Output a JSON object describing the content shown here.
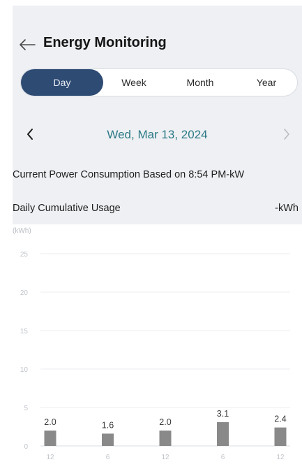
{
  "header": {
    "title": "Energy Monitoring"
  },
  "tabs": [
    {
      "label": "Day",
      "active": true
    },
    {
      "label": "Week",
      "active": false
    },
    {
      "label": "Month",
      "active": false
    },
    {
      "label": "Year",
      "active": false
    }
  ],
  "date": {
    "label": "Wed, Mar 13, 2024",
    "prev_icon": "chevron-left-icon",
    "next_icon": "chevron-right-icon"
  },
  "info": {
    "current_power_label": "Current Power Consumption Based on 8:54 PM",
    "current_power_value": "-kW",
    "daily_usage_label": "Daily Cumulative Usage",
    "daily_usage_value": "-kWh"
  },
  "colors": {
    "accent": "#2e4b73",
    "date": "#2d7a87",
    "bar": "#898989",
    "background": "#eef0f3"
  },
  "chart_data": {
    "type": "bar",
    "ylabel": "(kWh)",
    "ylim": [
      0,
      25
    ],
    "yticks": [
      0,
      5,
      10,
      15,
      20,
      25
    ],
    "x_tick_labels": [
      "12",
      "6",
      "12",
      "6",
      "12"
    ],
    "bars": [
      {
        "x_position": 0,
        "value": 2.0,
        "label": "2.0"
      },
      {
        "x_position": 1,
        "value": 1.6,
        "label": "1.6"
      },
      {
        "x_position": 2,
        "value": 2.0,
        "label": "2.0"
      },
      {
        "x_position": 3,
        "value": 3.1,
        "label": "3.1"
      },
      {
        "x_position": 4,
        "value": 2.4,
        "label": "2.4"
      }
    ],
    "grid": true
  }
}
